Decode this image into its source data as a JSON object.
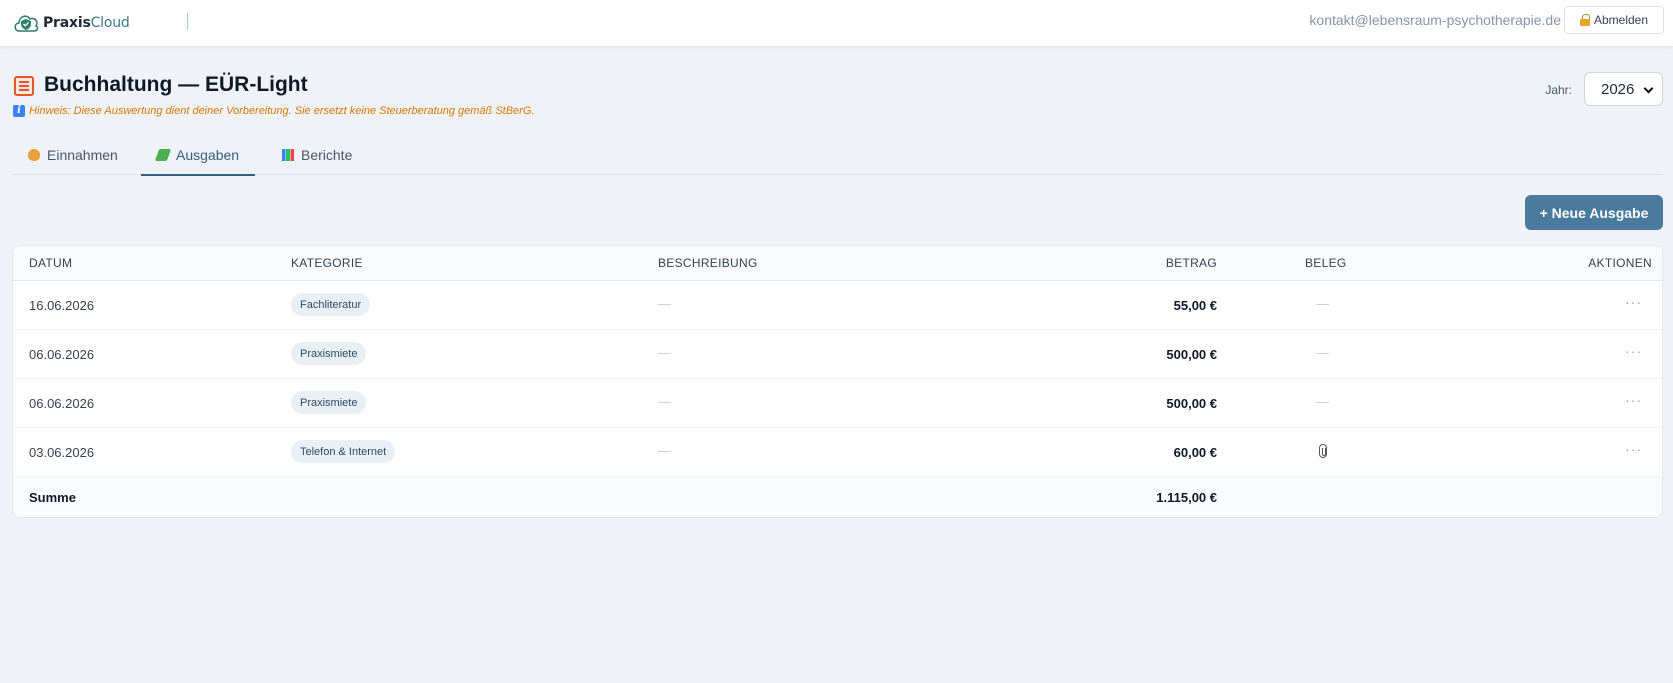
{
  "app": {
    "logo_part1": "Praxis",
    "logo_part2": "Cloud",
    "user_email": "kontakt@lebensraum-psychotherapie.de",
    "logout_label": "Abmelden"
  },
  "header": {
    "title": "Buchhaltung — EÜR-Light",
    "hint": "Hinweis: Diese Auswertung dient deiner Vorbereitung. Sie ersetzt keine Steuerberatung gemäß StBerG.",
    "year_label": "Jahr:",
    "year_value": "2026"
  },
  "tabs": [
    {
      "label": "Einnahmen",
      "icon": "money-bag-icon",
      "active": false
    },
    {
      "label": "Ausgaben",
      "icon": "money-with-wings-icon",
      "active": true
    },
    {
      "label": "Berichte",
      "icon": "bar-chart-icon",
      "active": false
    }
  ],
  "actions": {
    "new_expense": "+ Neue Ausgabe"
  },
  "table": {
    "columns": {
      "date": "DATUM",
      "category": "KATEGORIE",
      "description": "BESCHREIBUNG",
      "amount": "BETRAG",
      "receipt": "BELEG",
      "actions": "AKTIONEN"
    },
    "rows": [
      {
        "date": "16.06.2026",
        "category": "Fachliteratur",
        "description": "—",
        "amount": "55,00 €",
        "receipt": "—",
        "actions": "···"
      },
      {
        "date": "06.06.2026",
        "category": "Praxismiete",
        "description": "—",
        "amount": "500,00 €",
        "receipt": "—",
        "actions": "···"
      },
      {
        "date": "06.06.2026",
        "category": "Praxismiete",
        "description": "—",
        "amount": "500,00 €",
        "receipt": "—",
        "actions": "···"
      },
      {
        "date": "03.06.2026",
        "category": "Telefon & Internet",
        "description": "—",
        "amount": "60,00 €",
        "receipt": "paperclip-icon",
        "actions": "···"
      }
    ],
    "sum_label": "Summe",
    "sum_amount": "1.115,00 €"
  },
  "colors": {
    "accent": "#4a7a9e",
    "active_tab": "#36607f",
    "hint": "#d97706",
    "background": "#eff2f7"
  }
}
